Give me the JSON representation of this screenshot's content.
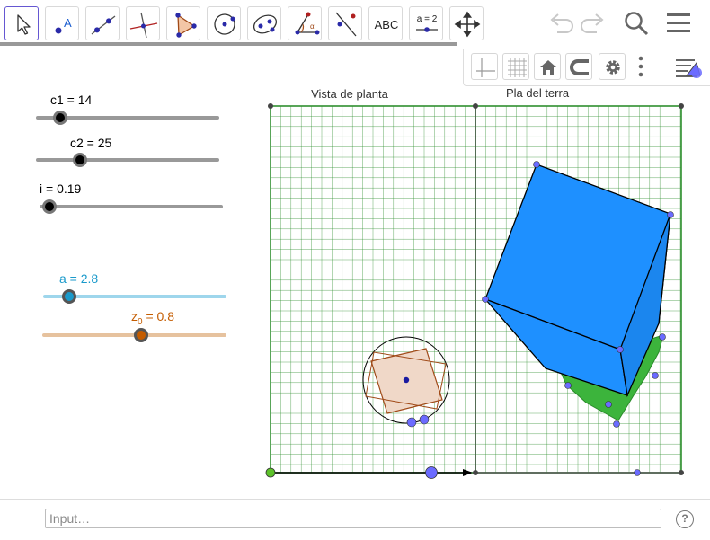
{
  "toolbar": {
    "tools": [
      {
        "name": "move-tool",
        "active": true
      },
      {
        "name": "point-tool",
        "label": "A"
      },
      {
        "name": "line-tool"
      },
      {
        "name": "perpendicular-line-tool"
      },
      {
        "name": "polygon-tool"
      },
      {
        "name": "circle-tool"
      },
      {
        "name": "conic-tool"
      },
      {
        "name": "angle-tool"
      },
      {
        "name": "reflect-tool"
      },
      {
        "name": "text-tool",
        "label": "ABC"
      },
      {
        "name": "slider-tool",
        "label": "a = 2"
      },
      {
        "name": "move-graphics-view-tool"
      }
    ],
    "undo_icon": "undo-icon",
    "redo_icon": "redo-icon",
    "search_icon": "search-icon",
    "menu_icon": "hamburger-menu-icon"
  },
  "graphics_style_bar": {
    "buttons": [
      "axes-toggle-icon",
      "grid-toggle-icon",
      "home-view-icon",
      "point-capturing-icon",
      "settings-gear-icon",
      "more-options-icon",
      "style-bar-toggle-icon"
    ]
  },
  "sliders": [
    {
      "label": "c1 = 14",
      "name": "c1",
      "value": 14,
      "color": "#000000",
      "track_color": "#999999"
    },
    {
      "label": "c2 = 25",
      "name": "c2",
      "value": 25,
      "color": "#000000",
      "track_color": "#999999"
    },
    {
      "label": "i = 0.19",
      "name": "i",
      "value": 0.19,
      "color": "#000000",
      "track_color": "#999999"
    },
    {
      "label": "a = 2.8",
      "name": "a",
      "value": 2.8,
      "color": "#1a9acb",
      "track_color": "#9ed6ec"
    },
    {
      "label_main": "z",
      "label_sub": "0",
      "label_rest": " = 0.8",
      "name": "z0",
      "value": 0.8,
      "color": "#c45c00",
      "track_color": "#e6c29e"
    }
  ],
  "views": {
    "left_title": "Vista de planta",
    "right_title": "Pla del terra"
  },
  "colors": {
    "grid": "#2f8f2f",
    "cube": "#1e90ff",
    "cube_edge": "#000000",
    "shadow": "#3cb43c",
    "square_fill": "#f0d8c8",
    "square_edge": "#a04a18",
    "point": "#6b6bff"
  },
  "input_bar": {
    "placeholder": "Input…",
    "help_icon": "help-icon",
    "help_label": "?"
  }
}
